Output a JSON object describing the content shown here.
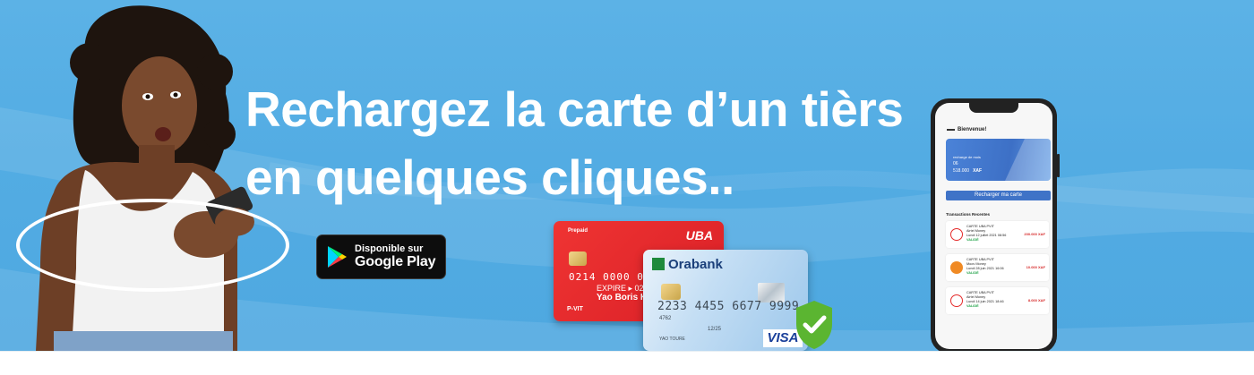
{
  "headline": {
    "line1": "Rechargez la carte d’un tièrs",
    "line2": "en quelques cliques.."
  },
  "store_badge": {
    "small": "Disponible sur",
    "big": "Google Play"
  },
  "uba_card": {
    "prepaid": "Prepaid",
    "brand": "UBA",
    "number": "0214  0000  000",
    "expiry": "EXPIRE ▸ 02/",
    "holder": "Yao Boris Ke",
    "tag": "P-VIT"
  },
  "orabank_card": {
    "brand": "Orabank",
    "number": "2233 4455 6677 9999",
    "code": "4762",
    "expiry": "12/25",
    "holder": "YAO TOURE",
    "network": "VISA"
  },
  "phone": {
    "welcome": "Bienvenue!",
    "balance_card": {
      "line1": "recharge de mois",
      "line2": "06",
      "amount": "518.000",
      "currency": "XAF"
    },
    "recharge_button": "Recharger ma carte",
    "recent_title": "Transactions Recentes",
    "transactions": [
      {
        "title": "CARTE UBA PVIT",
        "provider": "Airtel Money",
        "date": "Lundi 12 juillet 2021 08:56",
        "status": "VALIDÉ",
        "amount": "200.000 XAF",
        "icon": "airtel-icon",
        "color": "#e42a2a"
      },
      {
        "title": "CARTE UBA PVIT",
        "provider": "Moov Money",
        "date": "Lundi 28 juin 2021 16:06",
        "status": "VALIDÉ",
        "amount": "10.000 XAF",
        "icon": "moov-icon",
        "color": "#f08a24"
      },
      {
        "title": "CARTE UBA PVIT",
        "provider": "Airtel Money",
        "date": "Lundi 14 juin 2021 18:46",
        "status": "VALIDÉ",
        "amount": "8.000 XAF",
        "icon": "airtel-icon",
        "color": "#e42a2a"
      }
    ]
  },
  "colors": {
    "sky": "#53ace3",
    "uba_red": "#e32a2c",
    "shield_green": "#5bb531",
    "app_blue": "#3f73c7"
  }
}
